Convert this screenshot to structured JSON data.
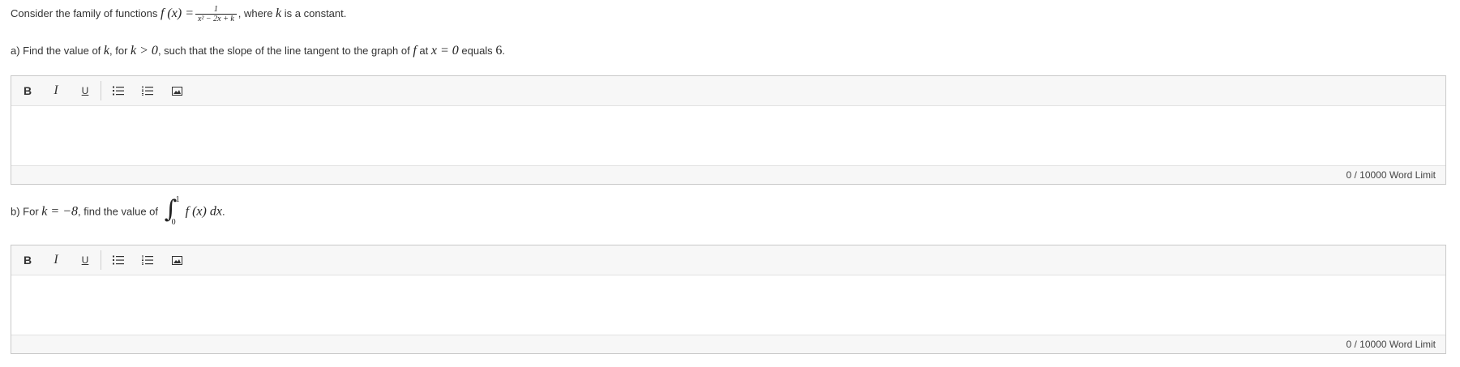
{
  "intro": {
    "prefix": "Consider the family of functions ",
    "func": "f (x) =",
    "frac_num": "1",
    "frac_den": "x² − 2x + k",
    "suffix_a": ", where ",
    "k": "k",
    "suffix_b": " is a constant."
  },
  "part_a": {
    "text_1": "a) Find the value of ",
    "k": "k",
    "text_2": ", for ",
    "cond": "k > 0",
    "text_3": ", such that the slope of the line tangent to the graph of ",
    "f": "f",
    "text_4": " at ",
    "xeq": "x = 0",
    "text_5": " equals ",
    "six": "6",
    "text_6": "."
  },
  "part_b": {
    "text_1": "b) For ",
    "keq": "k = −8",
    "text_2": ", find the value of ",
    "upper": "1",
    "lower": "0",
    "integrand": "f (x) dx",
    "text_3": "."
  },
  "toolbar": {
    "bold": "B",
    "italic": "I",
    "underline": "U"
  },
  "editors": {
    "word_limit": "0 / 10000 Word Limit"
  }
}
